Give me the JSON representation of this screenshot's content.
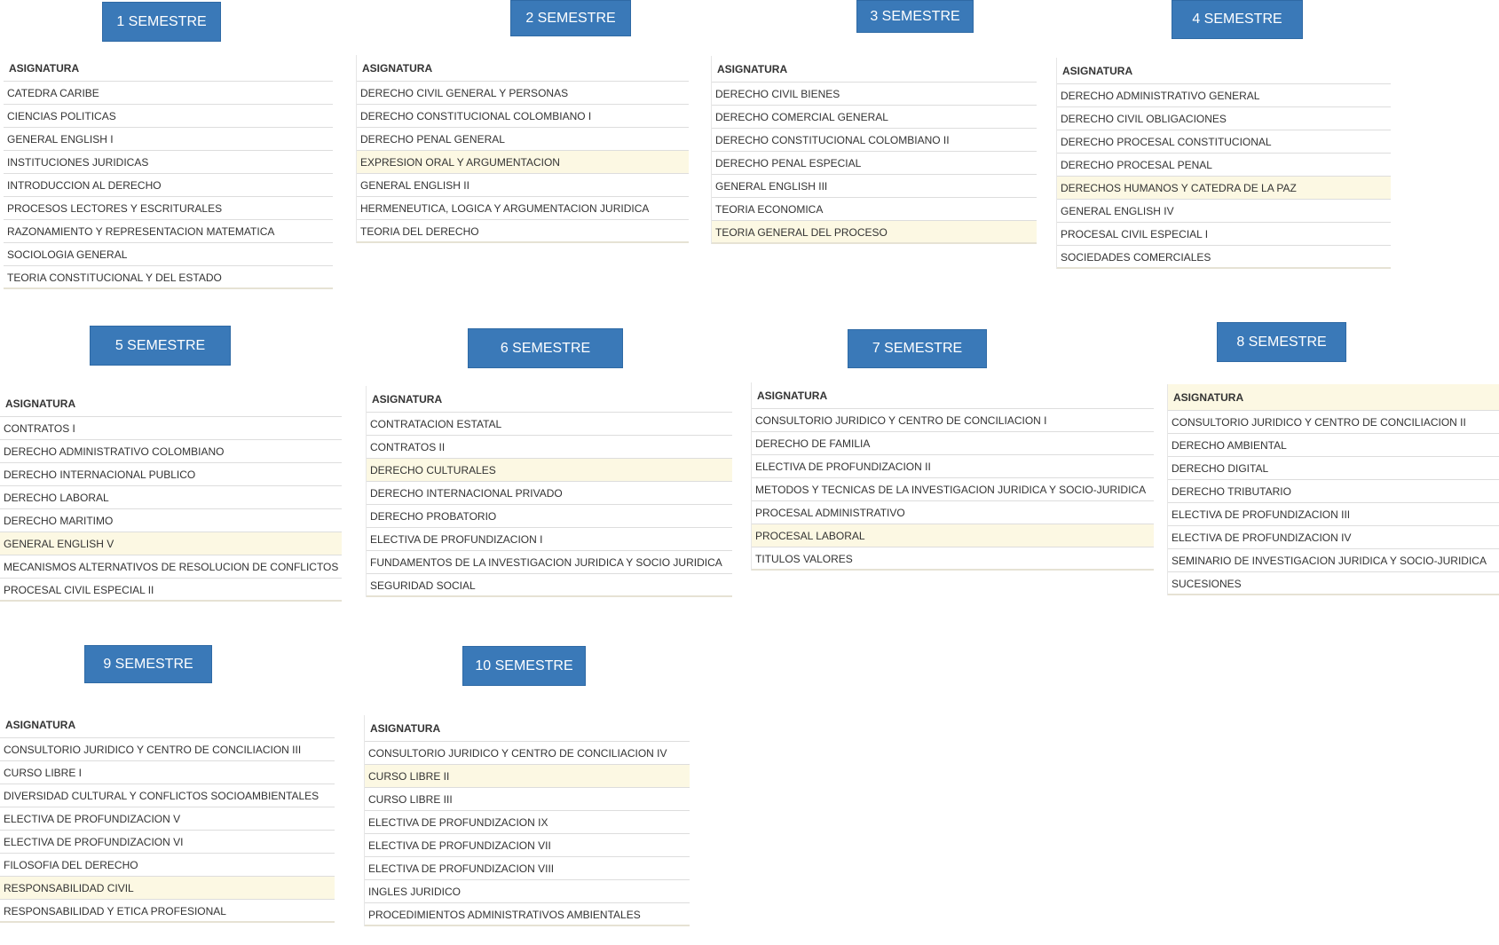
{
  "header_label": "ASIGNATURA",
  "colors": {
    "button_bg": "#3a79b8",
    "highlight_bg": "#fcf8e3",
    "text": "#333333"
  },
  "semesters": [
    {
      "title": "1 SEMESTRE",
      "courses": [
        {
          "name": "CATEDRA CARIBE"
        },
        {
          "name": "CIENCIAS POLITICAS"
        },
        {
          "name": "GENERAL ENGLISH I"
        },
        {
          "name": "INSTITUCIONES JURIDICAS"
        },
        {
          "name": "INTRODUCCION AL DERECHO"
        },
        {
          "name": "PROCESOS LECTORES Y ESCRITURALES"
        },
        {
          "name": "RAZONAMIENTO Y REPRESENTACION MATEMATICA"
        },
        {
          "name": "SOCIOLOGIA GENERAL"
        },
        {
          "name": "TEORIA CONSTITUCIONAL Y DEL ESTADO"
        }
      ]
    },
    {
      "title": "2 SEMESTRE",
      "courses": [
        {
          "name": "DERECHO CIVIL GENERAL Y PERSONAS"
        },
        {
          "name": "DERECHO CONSTITUCIONAL COLOMBIANO I"
        },
        {
          "name": "DERECHO PENAL GENERAL"
        },
        {
          "name": "EXPRESION ORAL Y ARGUMENTACION",
          "highlighted": true
        },
        {
          "name": "GENERAL ENGLISH II"
        },
        {
          "name": "HERMENEUTICA, LOGICA Y ARGUMENTACION JURIDICA"
        },
        {
          "name": "TEORIA DEL DERECHO"
        }
      ]
    },
    {
      "title": "3 SEMESTRE",
      "courses": [
        {
          "name": "DERECHO CIVIL BIENES"
        },
        {
          "name": "DERECHO COMERCIAL GENERAL"
        },
        {
          "name": "DERECHO CONSTITUCIONAL COLOMBIANO II"
        },
        {
          "name": "DERECHO PENAL ESPECIAL"
        },
        {
          "name": "GENERAL ENGLISH III"
        },
        {
          "name": "TEORIA ECONOMICA"
        },
        {
          "name": "TEORIA GENERAL DEL PROCESO",
          "highlighted": true
        }
      ]
    },
    {
      "title": "4 SEMESTRE",
      "courses": [
        {
          "name": "DERECHO ADMINISTRATIVO GENERAL"
        },
        {
          "name": "DERECHO CIVIL OBLIGACIONES"
        },
        {
          "name": "DERECHO PROCESAL CONSTITUCIONAL"
        },
        {
          "name": "DERECHO PROCESAL PENAL"
        },
        {
          "name": "DERECHOS HUMANOS Y CATEDRA DE LA PAZ",
          "highlighted": true
        },
        {
          "name": "GENERAL ENGLISH IV"
        },
        {
          "name": "PROCESAL CIVIL ESPECIAL I"
        },
        {
          "name": "SOCIEDADES COMERCIALES"
        }
      ]
    },
    {
      "title": "5 SEMESTRE",
      "courses": [
        {
          "name": "CONTRATOS I"
        },
        {
          "name": "DERECHO ADMINISTRATIVO COLOMBIANO"
        },
        {
          "name": "DERECHO INTERNACIONAL PUBLICO"
        },
        {
          "name": "DERECHO LABORAL"
        },
        {
          "name": "DERECHO MARITIMO"
        },
        {
          "name": "GENERAL ENGLISH V",
          "highlighted": true
        },
        {
          "name": "MECANISMOS ALTERNATIVOS DE RESOLUCION DE CONFLICTOS"
        },
        {
          "name": "PROCESAL CIVIL ESPECIAL II"
        }
      ]
    },
    {
      "title": "6 SEMESTRE",
      "courses": [
        {
          "name": "CONTRATACION ESTATAL"
        },
        {
          "name": "CONTRATOS II"
        },
        {
          "name": "DERECHO CULTURALES",
          "highlighted": true
        },
        {
          "name": "DERECHO INTERNACIONAL PRIVADO"
        },
        {
          "name": "DERECHO PROBATORIO"
        },
        {
          "name": "ELECTIVA DE PROFUNDIZACION I"
        },
        {
          "name": "FUNDAMENTOS DE LA INVESTIGACION JURIDICA Y SOCIO JURIDICA"
        },
        {
          "name": "SEGURIDAD SOCIAL"
        }
      ]
    },
    {
      "title": "7 SEMESTRE",
      "courses": [
        {
          "name": "CONSULTORIO JURIDICO Y CENTRO DE CONCILIACION I"
        },
        {
          "name": "DERECHO DE FAMILIA"
        },
        {
          "name": "ELECTIVA DE PROFUNDIZACION II"
        },
        {
          "name": "METODOS Y TECNICAS DE LA INVESTIGACION JURIDICA Y SOCIO-JURIDICA"
        },
        {
          "name": "PROCESAL ADMINISTRATIVO"
        },
        {
          "name": "PROCESAL LABORAL",
          "highlighted": true
        },
        {
          "name": "TITULOS VALORES"
        }
      ]
    },
    {
      "title": "8 SEMESTRE",
      "header_highlighted": true,
      "courses": [
        {
          "name": "CONSULTORIO JURIDICO Y CENTRO DE CONCILIACION II"
        },
        {
          "name": "DERECHO AMBIENTAL"
        },
        {
          "name": "DERECHO DIGITAL"
        },
        {
          "name": "DERECHO TRIBUTARIO"
        },
        {
          "name": "ELECTIVA DE PROFUNDIZACION III"
        },
        {
          "name": "ELECTIVA DE PROFUNDIZACION IV"
        },
        {
          "name": "SEMINARIO DE INVESTIGACION JURIDICA Y SOCIO-JURIDICA"
        },
        {
          "name": "SUCESIONES"
        }
      ]
    },
    {
      "title": "9 SEMESTRE",
      "courses": [
        {
          "name": "CONSULTORIO JURIDICO Y CENTRO DE CONCILIACION III"
        },
        {
          "name": "CURSO LIBRE I"
        },
        {
          "name": "DIVERSIDAD CULTURAL Y CONFLICTOS SOCIOAMBIENTALES"
        },
        {
          "name": "ELECTIVA DE PROFUNDIZACION V"
        },
        {
          "name": "ELECTIVA DE PROFUNDIZACION VI"
        },
        {
          "name": "FILOSOFIA DEL DERECHO"
        },
        {
          "name": "RESPONSABILIDAD CIVIL",
          "highlighted": true
        },
        {
          "name": "RESPONSABILIDAD Y ETICA PROFESIONAL"
        }
      ]
    },
    {
      "title": "10 SEMESTRE",
      "courses": [
        {
          "name": "CONSULTORIO JURIDICO Y CENTRO DE CONCILIACION IV"
        },
        {
          "name": "CURSO LIBRE II",
          "highlighted": true
        },
        {
          "name": "CURSO LIBRE III"
        },
        {
          "name": "ELECTIVA DE PROFUNDIZACION IX"
        },
        {
          "name": "ELECTIVA DE PROFUNDIZACION VII"
        },
        {
          "name": "ELECTIVA DE PROFUNDIZACION VIII"
        },
        {
          "name": "INGLES JURIDICO"
        },
        {
          "name": "PROCEDIMIENTOS ADMINISTRATIVOS AMBIENTALES"
        }
      ]
    }
  ]
}
